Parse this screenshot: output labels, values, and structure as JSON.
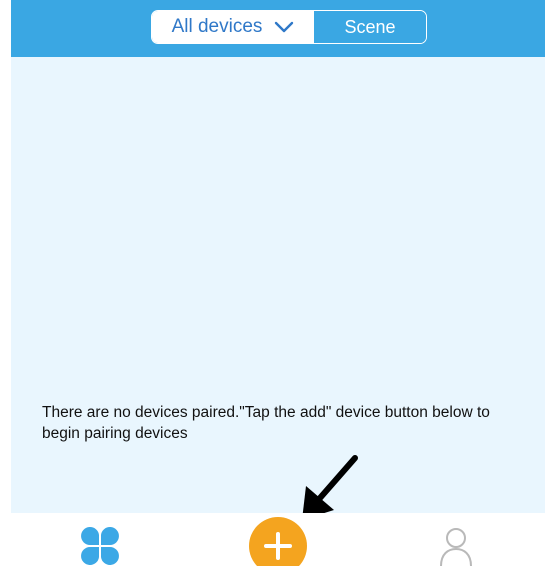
{
  "header": {
    "tabs": [
      {
        "label": "All devices",
        "selected": true
      },
      {
        "label": "Scene",
        "selected": false
      }
    ]
  },
  "main": {
    "empty_message": "There are no devices paired.\"Tap the add\" device button below to begin pairing devices"
  },
  "bottom_nav": {
    "items": [
      {
        "icon": "four-leaf-home-icon"
      },
      {
        "icon": "add-icon"
      },
      {
        "icon": "user-profile-icon"
      }
    ]
  },
  "colors": {
    "header_background": "#3aa7e3",
    "content_background": "#e9f6fe",
    "selected_tab_text": "#2f78c8",
    "add_button": "#f4a41f",
    "profile_icon": "#b9b9b9"
  }
}
